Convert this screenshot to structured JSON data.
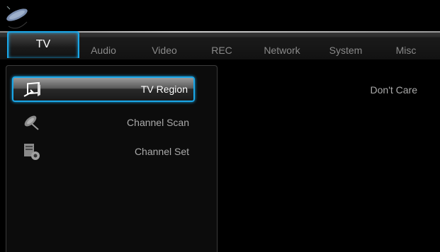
{
  "tabs": [
    "TV",
    "Audio",
    "Video",
    "REC",
    "Network",
    "System",
    "Misc"
  ],
  "active_tab": "TV",
  "menu": {
    "items": [
      {
        "label": "TV Region",
        "icon": "tv-region-icon"
      },
      {
        "label": "Channel Scan",
        "icon": "satellite-dish-icon"
      },
      {
        "label": "Channel Set",
        "icon": "channel-set-gear-icon"
      }
    ],
    "selected_index": 0
  },
  "setting_value": "Don't Care",
  "colors": {
    "accent": "#1aa7e8",
    "background": "#000000",
    "text_inactive": "#8a8a8a",
    "text_active": "#ffffff"
  }
}
